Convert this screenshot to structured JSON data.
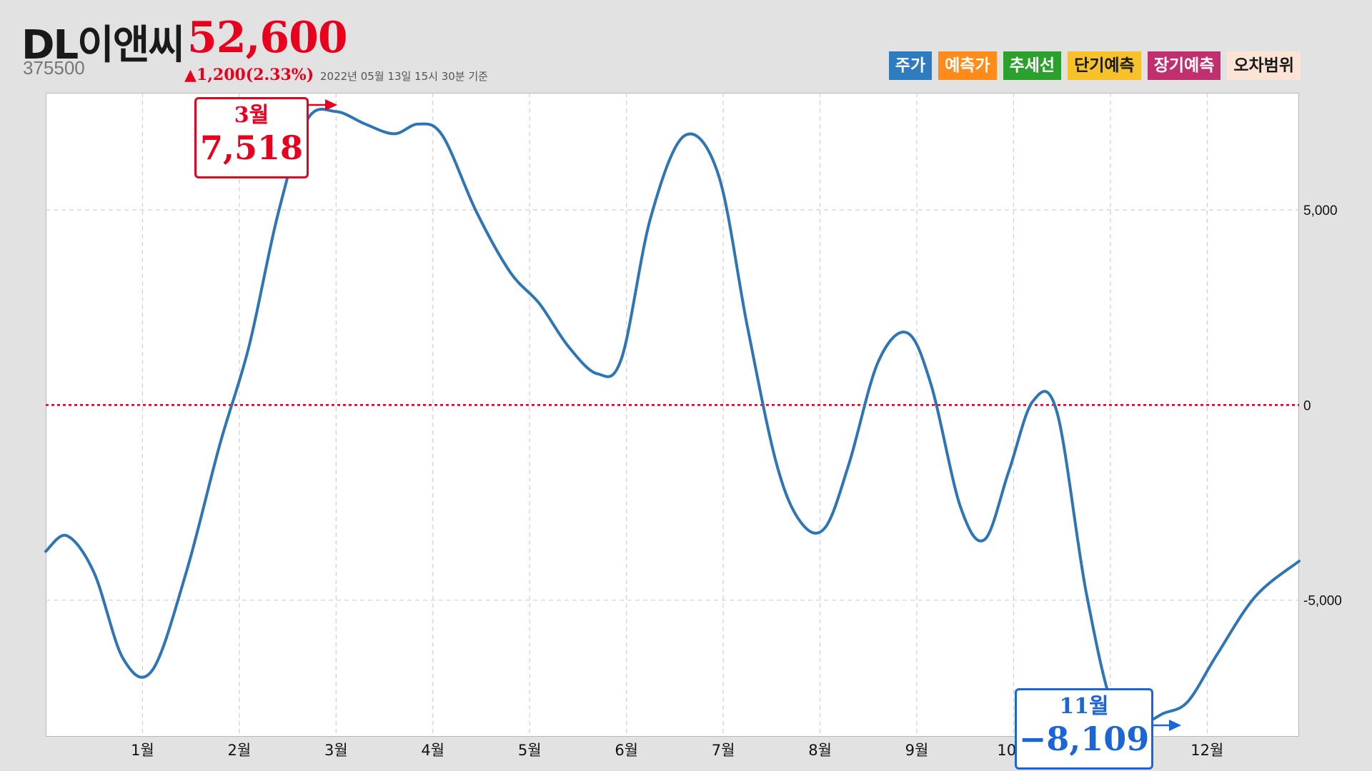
{
  "header": {
    "name": "DL이앤씨",
    "price": "52,600",
    "code": "375500",
    "change": "▲1,200(2.33%)",
    "date": "2022년 05월 13일 15시 30분 기준"
  },
  "legend": [
    {
      "label": "주가",
      "color": "#2e7cbf",
      "text_color": "#ffffff"
    },
    {
      "label": "예측가",
      "color": "#ff8c1a",
      "text_color": "#ffffff"
    },
    {
      "label": "추세선",
      "color": "#2ca02c",
      "text_color": "#ffffff"
    },
    {
      "label": "단기예측",
      "color": "#f7c12a",
      "text_color": "#1a1a1a"
    },
    {
      "label": "장기예측",
      "color": "#c0306e",
      "text_color": "#ffffff"
    },
    {
      "label": "오차범위",
      "color": "#fbe3d6",
      "text_color": "#1a1a1a"
    }
  ],
  "callouts": {
    "max": {
      "month": "3월",
      "value": "7,518",
      "color": "#e8001c"
    },
    "min": {
      "month": "11월",
      "value": "−8,109",
      "color": "#1a66d6"
    }
  },
  "chart_data": {
    "type": "line",
    "line_color": "#2e75b6",
    "zero_line_color": "#e8001c",
    "ylim": [
      -8500,
      8000
    ],
    "xlim": [
      0.0,
      12.95
    ],
    "y_ticks": [
      5000,
      0,
      -5000
    ],
    "y_tick_labels": [
      "5,000",
      "0",
      "-5,000"
    ],
    "x_ticks": [
      1,
      2,
      3,
      4,
      5,
      6,
      7,
      8,
      9,
      10,
      11,
      12
    ],
    "x_tick_labels": [
      "1월",
      "2월",
      "3월",
      "4월",
      "5월",
      "6월",
      "7월",
      "8월",
      "9월",
      "10월",
      "",
      "12월"
    ],
    "grid": true,
    "series": [
      {
        "x": [
          0.0,
          0.22,
          0.5,
          0.8,
          1.1,
          1.45,
          1.8,
          2.1,
          2.4,
          2.7,
          3.0,
          3.3,
          3.6,
          3.85,
          4.1,
          4.45,
          4.8,
          5.1,
          5.4,
          5.7,
          5.95,
          6.25,
          6.6,
          6.95,
          7.25,
          7.55,
          7.8,
          8.05,
          8.3,
          8.6,
          8.9,
          9.15,
          9.45,
          9.7,
          9.95,
          10.2,
          10.45,
          10.75,
          11.05,
          11.35,
          11.55,
          11.8,
          12.1,
          12.5,
          12.95
        ],
        "y": [
          -3750,
          -3350,
          -4300,
          -6500,
          -6800,
          -4300,
          -1000,
          1500,
          4900,
          7300,
          7518,
          7200,
          6950,
          7200,
          6900,
          4950,
          3400,
          2600,
          1500,
          800,
          1200,
          4800,
          6900,
          5900,
          2000,
          -1500,
          -3000,
          -3150,
          -1500,
          1100,
          1850,
          500,
          -2600,
          -3450,
          -1700,
          100,
          -200,
          -4800,
          -7900,
          -8109,
          -7900,
          -7600,
          -6400,
          -4900,
          -4000
        ]
      }
    ]
  }
}
